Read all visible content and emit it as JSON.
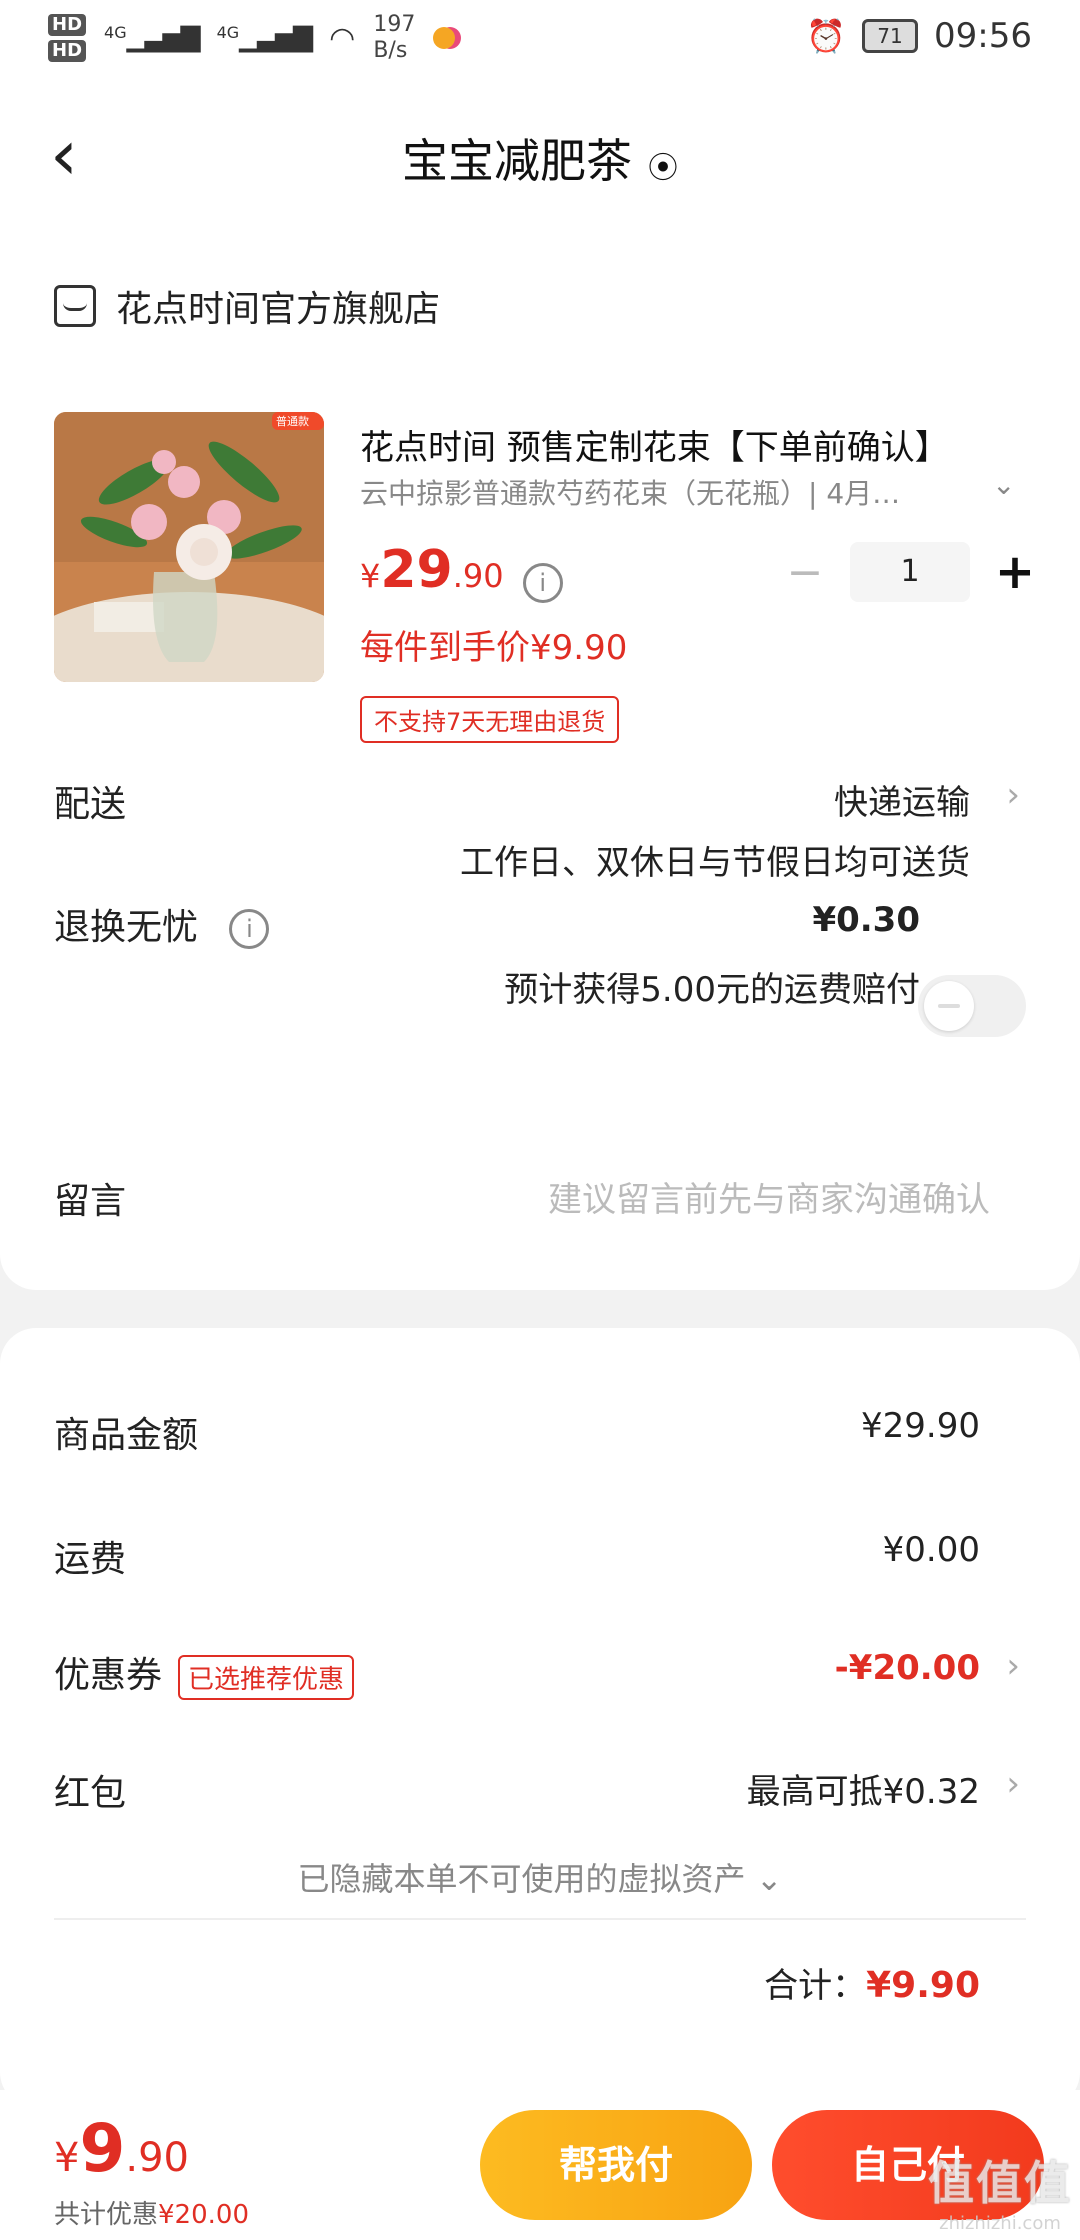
{
  "status_bar": {
    "hd1": "HD",
    "hd2": "HD",
    "net1": "4G",
    "net2": "4G",
    "speed_value": "197",
    "speed_unit": "B/s",
    "battery": "71",
    "time": "09:56"
  },
  "nav": {
    "title": "宝宝减肥茶"
  },
  "shop": {
    "name": "花点时间官方旗舰店"
  },
  "product": {
    "title": "花点时间 预售定制花束【下单前确认】",
    "spec": "云中掠影普通款芍药花束（无花瓶）| 4月…",
    "badge": "普通款",
    "price_symbol": "¥",
    "price_int": "29",
    "price_dec": ".90",
    "hand_price": "每件到手价¥9.90",
    "no_return": "不支持7天无理由退货",
    "quantity": "1"
  },
  "delivery": {
    "label": "配送",
    "method": "快递运输",
    "note": "工作日、双休日与节假日均可送货"
  },
  "return_insurance": {
    "label": "退换无忧",
    "price": "¥0.30",
    "note": "预计获得5.00元的运费赔付",
    "enabled": false
  },
  "remark": {
    "label": "留言",
    "placeholder": "建议留言前先与商家沟通确认"
  },
  "summary": {
    "goods_label": "商品金额",
    "goods_value": "¥29.90",
    "shipping_label": "运费",
    "shipping_value": "¥0.00",
    "coupon_label": "优惠券",
    "coupon_badge": "已选推荐优惠",
    "coupon_value": "-¥20.00",
    "redpacket_label": "红包",
    "redpacket_value": "最高可抵¥0.32",
    "hidden_assets": "已隐藏本单不可使用的虚拟资产",
    "total_label": "合计：",
    "total_value": "¥9.90"
  },
  "footer": {
    "price_symbol": "¥",
    "price_int": "9",
    "price_dec": ".90",
    "discount_label": "共计优惠",
    "discount_value": "¥20.00",
    "help_pay": "帮我付",
    "self_pay": "自己付"
  },
  "watermark": {
    "logo": "值值值",
    "url": "zhizhizhi.com"
  },
  "colors": {
    "accent_red": "#e02e24",
    "help_orange": "#fdbb21",
    "self_red": "#ff4d2d"
  }
}
